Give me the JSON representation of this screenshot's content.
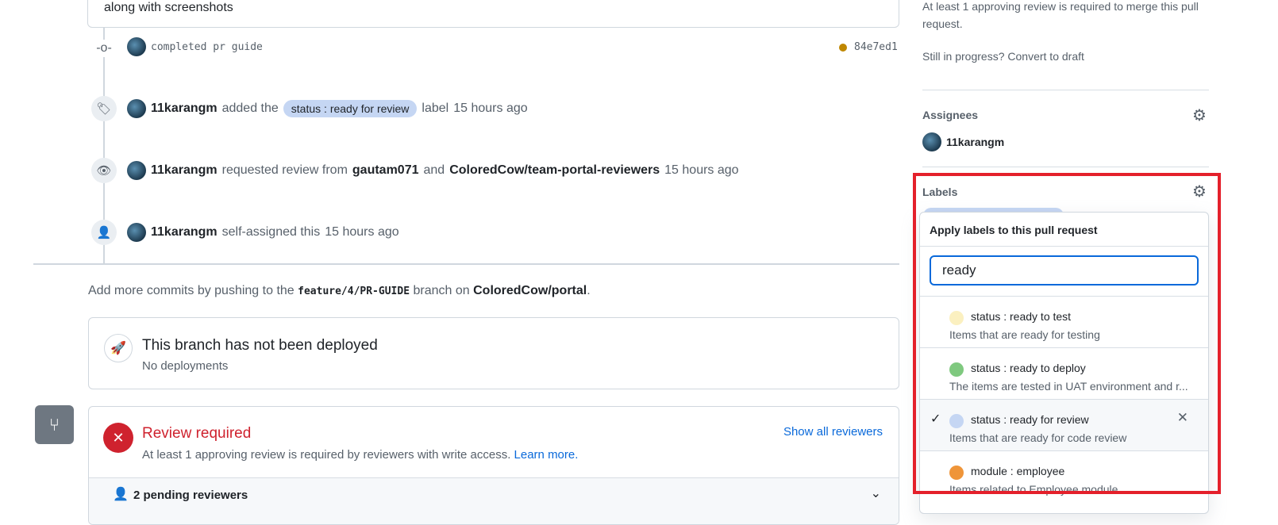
{
  "comment": {
    "text": "along with screenshots"
  },
  "timeline": {
    "commit": {
      "message": "completed pr guide",
      "sha": "84e7ed1",
      "status_color": "#bf8700"
    },
    "label_event": {
      "user": "11karangm",
      "pre": "added the",
      "label": "status : ready for review",
      "post": "label",
      "time": "15 hours ago"
    },
    "review_event": {
      "user": "11karangm",
      "pre": "requested review from",
      "reviewer1": "gautam071",
      "and": "and",
      "reviewer2": "ColoredCow/team-portal-reviewers",
      "time": "15 hours ago"
    },
    "assign_event": {
      "user": "11karangm",
      "text": "self-assigned this",
      "time": "15 hours ago"
    }
  },
  "branch_note": {
    "pre": "Add more commits by pushing to the",
    "branch": "feature/4/PR-GUIDE",
    "mid": "branch on",
    "repo": "ColoredCow/portal",
    "end": "."
  },
  "deploy": {
    "title": "This branch has not been deployed",
    "subtitle": "No deployments"
  },
  "review": {
    "title": "Review required",
    "text": "At least 1 approving review is required by reviewers with write access.",
    "learn_more": "Learn more.",
    "show_all": "Show all reviewers",
    "pending": "2 pending reviewers"
  },
  "sidebar": {
    "merge_note": "At least 1 approving review is required to merge this pull request.",
    "in_progress": "Still in progress?",
    "convert": "Convert to draft",
    "assignees_title": "Assignees",
    "assignee": "11karangm",
    "labels_title": "Labels"
  },
  "label_popup": {
    "title": "Apply labels to this pull request",
    "filter_value": "ready",
    "items": [
      {
        "name": "status : ready to test",
        "desc": "Items that are ready for testing",
        "color": "#fbf0c0",
        "selected": false
      },
      {
        "name": "status : ready to deploy",
        "desc": "The items are tested in UAT environment and r...",
        "color": "#7fc97f",
        "selected": false
      },
      {
        "name": "status : ready for review",
        "desc": "Items that are ready for code review",
        "color": "#c5d6f3",
        "selected": true
      },
      {
        "name": "module : employee",
        "desc": "Items related to Employee module",
        "color": "#ef9539",
        "selected": false
      }
    ]
  }
}
